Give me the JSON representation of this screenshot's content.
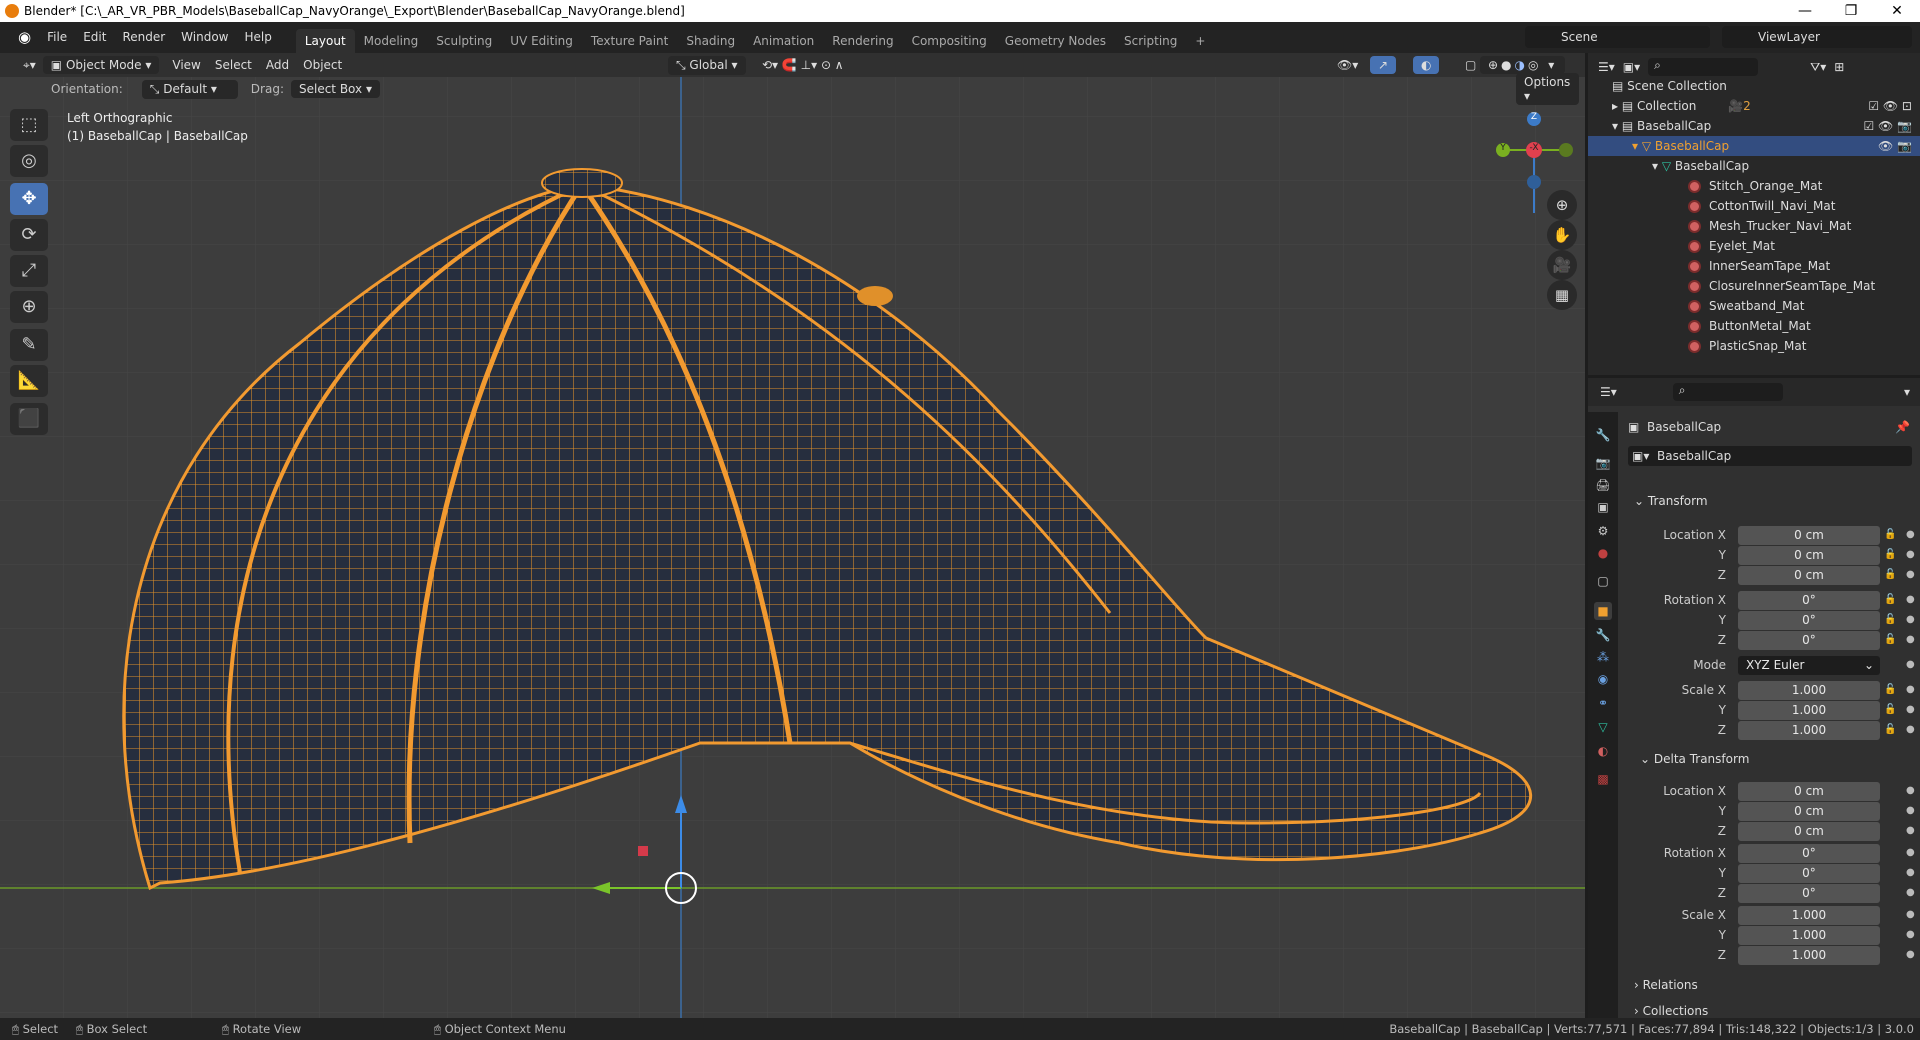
{
  "window": {
    "title": "Blender* [C:\\_AR_VR_PBR_Models\\BaseballCap_NavyOrange\\_Export\\Blender\\BaseballCap_NavyOrange.blend]",
    "minimize": "—",
    "maximize": "❐",
    "close": "✕"
  },
  "menu": [
    "File",
    "Edit",
    "Render",
    "Window",
    "Help"
  ],
  "workspaces": [
    "Layout",
    "Modeling",
    "Sculpting",
    "UV Editing",
    "Texture Paint",
    "Shading",
    "Animation",
    "Rendering",
    "Compositing",
    "Geometry Nodes",
    "Scripting",
    "+"
  ],
  "scene": {
    "label": "Scene",
    "viewlayer": "ViewLayer"
  },
  "viewport_header": {
    "mode": "Object Mode",
    "items": [
      "View",
      "Select",
      "Add",
      "Object"
    ],
    "transform": "Global",
    "orientation_label": "Orientation:",
    "orientation": "Default",
    "drag_label": "Drag:",
    "drag": "Select Box",
    "options": "Options"
  },
  "viewport": {
    "view_name": "Left Orthographic",
    "object_info": "(1) BaseballCap | BaseballCap",
    "gizmo": {
      "z": "Z",
      "y": "Y",
      "x": "-X"
    }
  },
  "outliner": {
    "root": "Scene Collection",
    "collection": "Collection",
    "collection_badge": "2",
    "cap_collection": "BaseballCap",
    "object": "BaseballCap",
    "mesh": "BaseballCap",
    "materials": [
      "Stitch_Orange_Mat",
      "CottonTwill_Navi_Mat",
      "Mesh_Trucker_Navi_Mat",
      "Eyelet_Mat",
      "InnerSeamTape_Mat",
      "ClosureInnerSeamTape_Mat",
      "Sweatband_Mat",
      "ButtonMetal_Mat",
      "PlasticSnap_Mat"
    ]
  },
  "properties": {
    "object_name": "BaseballCap",
    "name_field": "BaseballCap",
    "transform": {
      "title": "Transform",
      "rows": [
        {
          "label": "Location X",
          "value": "0 cm"
        },
        {
          "label": "Y",
          "value": "0 cm"
        },
        {
          "label": "Z",
          "value": "0 cm"
        },
        {
          "label": "Rotation X",
          "value": "0°"
        },
        {
          "label": "Y",
          "value": "0°"
        },
        {
          "label": "Z",
          "value": "0°"
        },
        {
          "label": "Mode",
          "value": "XYZ Euler"
        },
        {
          "label": "Scale X",
          "value": "1.000"
        },
        {
          "label": "Y",
          "value": "1.000"
        },
        {
          "label": "Z",
          "value": "1.000"
        }
      ]
    },
    "delta": {
      "title": "Delta Transform",
      "rows": [
        {
          "label": "Location X",
          "value": "0 cm"
        },
        {
          "label": "Y",
          "value": "0 cm"
        },
        {
          "label": "Z",
          "value": "0 cm"
        },
        {
          "label": "Rotation X",
          "value": "0°"
        },
        {
          "label": "Y",
          "value": "0°"
        },
        {
          "label": "Z",
          "value": "0°"
        },
        {
          "label": "Scale X",
          "value": "1.000"
        },
        {
          "label": "Y",
          "value": "1.000"
        },
        {
          "label": "Z",
          "value": "1.000"
        }
      ]
    },
    "relations": "Relations",
    "collections": "Collections"
  },
  "status": {
    "select": "Select",
    "box_select": "Box Select",
    "rotate": "Rotate View",
    "context": "Object Context Menu",
    "stats": "BaseballCap | BaseballCap | Verts:77,571 | Faces:77,894 | Tris:148,322 | Objects:1/3 | 3.0.0"
  },
  "colors": {
    "accent": "#4772b3",
    "wire": "#f0962a",
    "navy": "#2a3344"
  }
}
